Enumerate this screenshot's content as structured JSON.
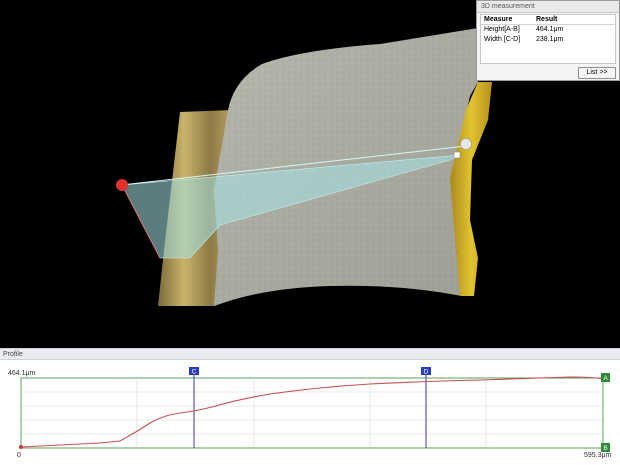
{
  "measure_panel": {
    "title": "3D measurement",
    "headers": [
      "Measure",
      "Result"
    ],
    "rows": [
      {
        "measure": "Height[A-B]",
        "result": "464.1μm"
      },
      {
        "measure": "Width [C-D]",
        "result": "238.1μm"
      }
    ],
    "list_button": "List >>"
  },
  "profile": {
    "title": "Profile",
    "y_max_label": "464.1μm",
    "x_min_label": "0",
    "x_max_label": "595.3μm",
    "marker_A": "A",
    "marker_B": "B",
    "marker_C": "C",
    "marker_D": "D"
  },
  "colors": {
    "profile_line": "#c85050",
    "grid_frame": "#5aa05a",
    "marker_line": "#3a3aa0",
    "marker_box_blue": "#2a3cc0",
    "marker_box_green": "#2e8b3a",
    "measure_band": "#a6e4e8",
    "point_a": "#e03030"
  }
}
